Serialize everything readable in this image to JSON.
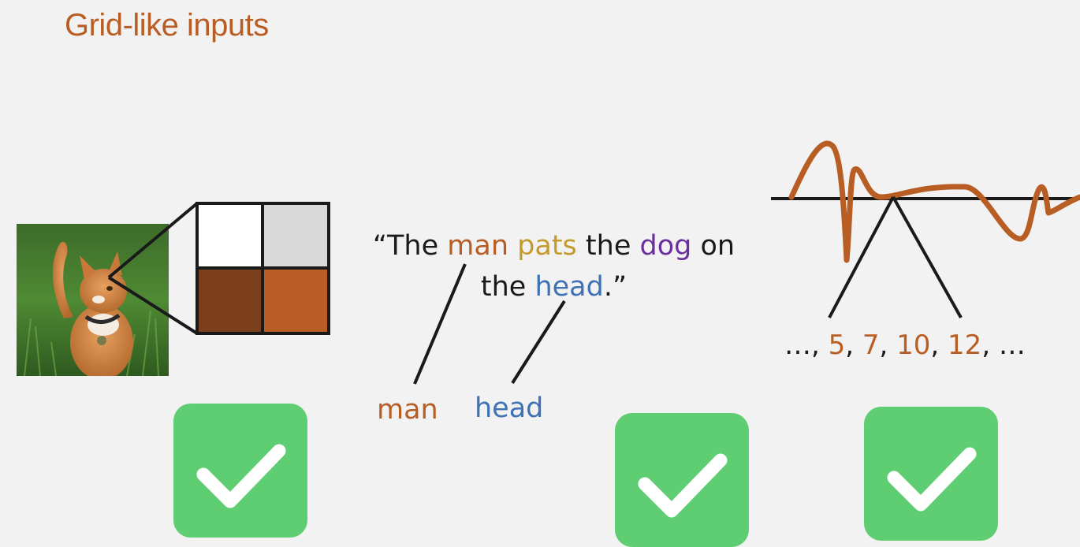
{
  "title": "Grid-like inputs",
  "colors": {
    "title": "#b85e24",
    "man": "#b85e24",
    "pats": "#c49a2a",
    "dog": "#6b2f9e",
    "head": "#3f72b5",
    "pixel_light": "#ffffff",
    "pixel_grey": "#d9d9d9",
    "pixel_dark_brown": "#7b3f1c",
    "pixel_brown": "#b85e24",
    "wave": "#b85e24",
    "check_bg": "#5fce72"
  },
  "image": {
    "icon": "cat-photo"
  },
  "sentence": {
    "open_quote": "“The ",
    "man": "man",
    "pats": "pats",
    "the": " the ",
    "dog": "dog",
    "on": " on",
    "line2_prefix": "the ",
    "head": "head",
    "close": ".”"
  },
  "word_labels": {
    "man": "man",
    "head": "head"
  },
  "sequence": {
    "prefix": "…, ",
    "values": [
      "5",
      "7",
      "10",
      "12"
    ],
    "sep": ", ",
    "suffix": ", …"
  },
  "checkmarks": [
    {
      "icon": "checkmark-icon"
    },
    {
      "icon": "checkmark-icon"
    },
    {
      "icon": "checkmark-icon"
    }
  ]
}
